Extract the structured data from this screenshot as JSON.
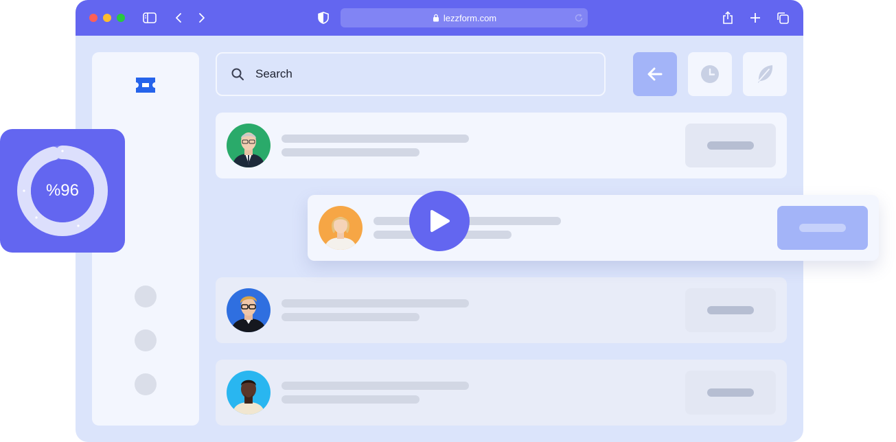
{
  "browser": {
    "url": "lezzform.com"
  },
  "search": {
    "placeholder": "Search"
  },
  "progress": {
    "label": "%96",
    "value": 96
  },
  "colors": {
    "accent": "#6366f0",
    "window_bg": "#dbe4fb",
    "panel_bg": "#f3f6fe",
    "highlight_button": "#a3b4f8"
  },
  "rows": [
    {
      "avatar_bg": "#2aaa6a",
      "state": "normal"
    },
    {
      "avatar_bg": "#f6a645",
      "state": "highlighted"
    },
    {
      "avatar_bg": "#2f6fe0",
      "state": "normal"
    },
    {
      "avatar_bg": "#29b6f0",
      "state": "normal"
    }
  ],
  "icons": {
    "sidebar_logo": "ticket-icon",
    "action_buttons": [
      "arrow-left-icon",
      "clock-icon",
      "feather-icon"
    ]
  }
}
